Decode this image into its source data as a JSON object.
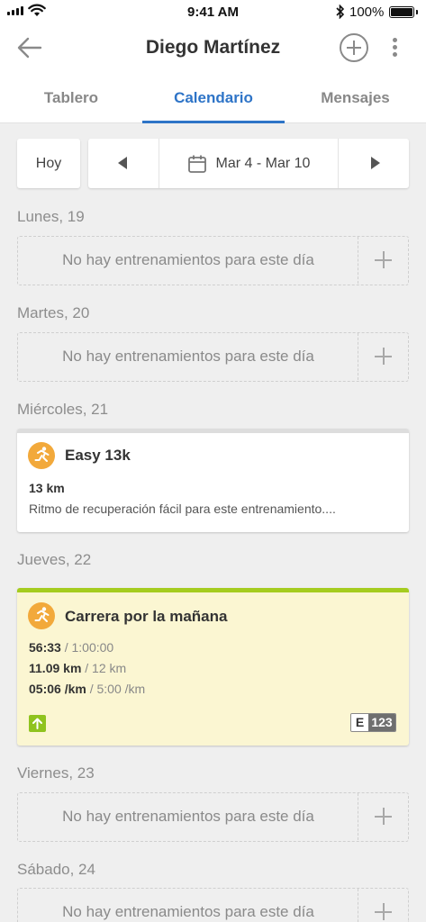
{
  "status_bar": {
    "time": "9:41 AM",
    "battery": "100%"
  },
  "header": {
    "title": "Diego Martínez"
  },
  "tabs": [
    {
      "label": "Tablero"
    },
    {
      "label": "Calendario"
    },
    {
      "label": "Mensajes"
    }
  ],
  "date_nav": {
    "today_label": "Hoy",
    "range_label": "Mar 4 - Mar 10"
  },
  "empty_message": "No hay entrenamientos para este día",
  "days": [
    {
      "heading": "Lunes, 19"
    },
    {
      "heading": "Martes, 20"
    },
    {
      "heading": "Miércoles, 21"
    },
    {
      "heading": "Jueves, 22"
    },
    {
      "heading": "Viernes, 23"
    },
    {
      "heading": "Sábado, 24"
    }
  ],
  "workouts": {
    "wednesday": {
      "name": "Easy 13k",
      "distance": "13 km",
      "description": "Ritmo de recuperación fácil para este entrenamiento...."
    },
    "thursday": {
      "name": "Carrera por la mañana",
      "time_actual": "56:33",
      "time_target": "/ 1:00:00",
      "distance_actual": "11.09 km",
      "distance_target": "/ 12 km",
      "pace_actual": "05:06 /km",
      "pace_target": "/ 5:00 /km",
      "effort_key": "E",
      "effort_value": "123"
    }
  },
  "colors": {
    "accent": "#2e74c7",
    "run_icon": "#f2a93b",
    "completed_bar": "#a5cc1f",
    "completed_bg": "#fbf6d2",
    "upcoming_bar": "#dddddd"
  }
}
